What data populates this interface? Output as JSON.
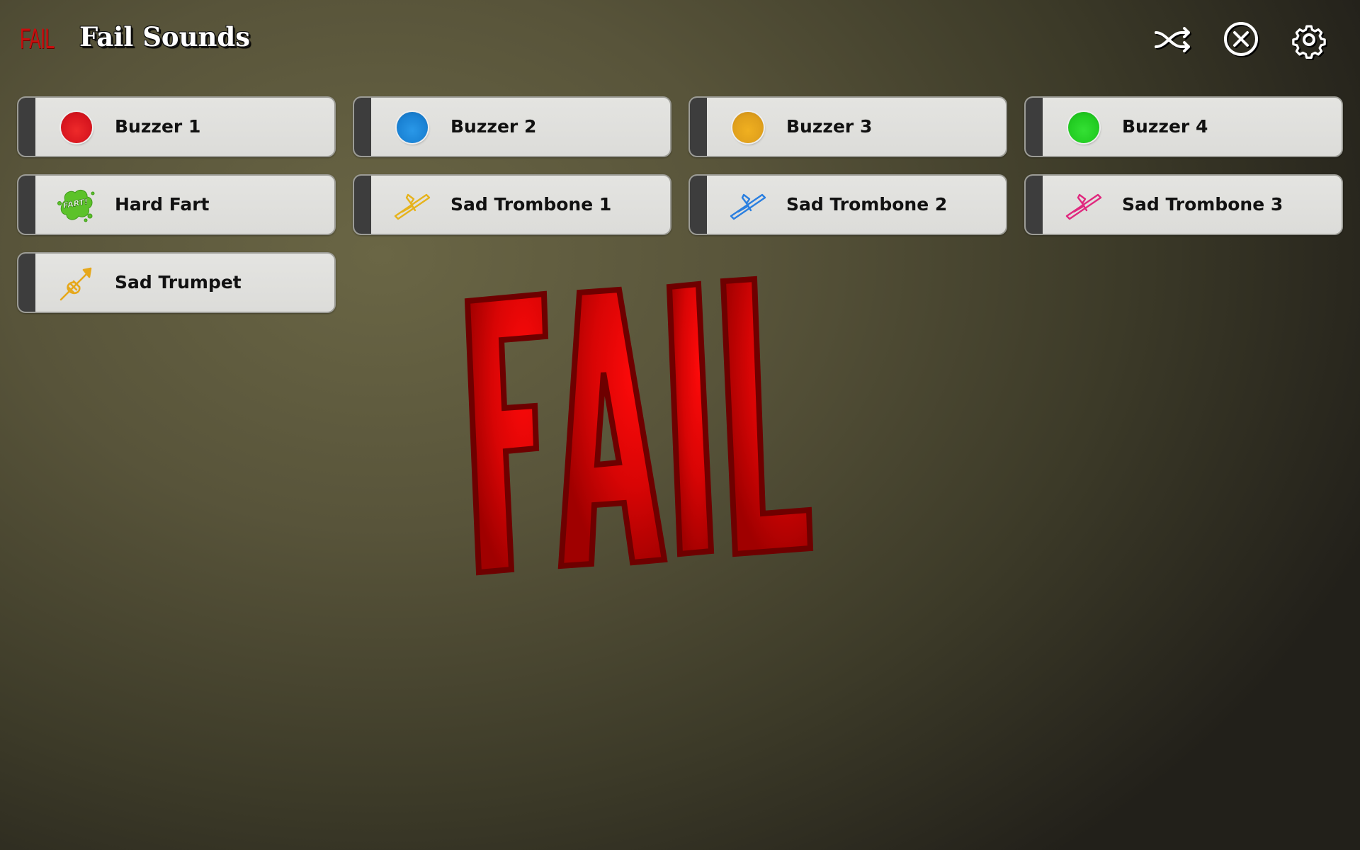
{
  "header": {
    "logo_text": "FAIL",
    "title": "Fail Sounds",
    "actions": [
      {
        "name": "shuffle",
        "icon": "shuffle-icon"
      },
      {
        "name": "stop",
        "icon": "close-circle-icon"
      },
      {
        "name": "settings",
        "icon": "gear-icon"
      }
    ]
  },
  "sounds": [
    {
      "label": "Buzzer 1",
      "icon": "buzzer-icon",
      "color": "#e31b23"
    },
    {
      "label": "Buzzer 2",
      "icon": "buzzer-icon",
      "color": "#1e88d8"
    },
    {
      "label": "Buzzer 3",
      "icon": "buzzer-icon",
      "color": "#e6a21c"
    },
    {
      "label": "Buzzer 4",
      "icon": "buzzer-icon",
      "color": "#22cc22"
    },
    {
      "label": "Hard Fart",
      "icon": "fart-cloud-icon",
      "color": "#5cc22a",
      "icon_text": "FART!"
    },
    {
      "label": "Sad Trombone 1",
      "icon": "trombone-icon",
      "color": "#e6b31c"
    },
    {
      "label": "Sad Trombone 2",
      "icon": "trombone-icon",
      "color": "#2a7fe0"
    },
    {
      "label": "Sad Trombone 3",
      "icon": "trombone-icon",
      "color": "#e0287e"
    },
    {
      "label": "Sad Trumpet",
      "icon": "trumpet-icon",
      "color": "#e6a81c"
    }
  ],
  "banner": {
    "text": "FAIL",
    "fill": "#e00000",
    "outline": "#6e0000"
  }
}
